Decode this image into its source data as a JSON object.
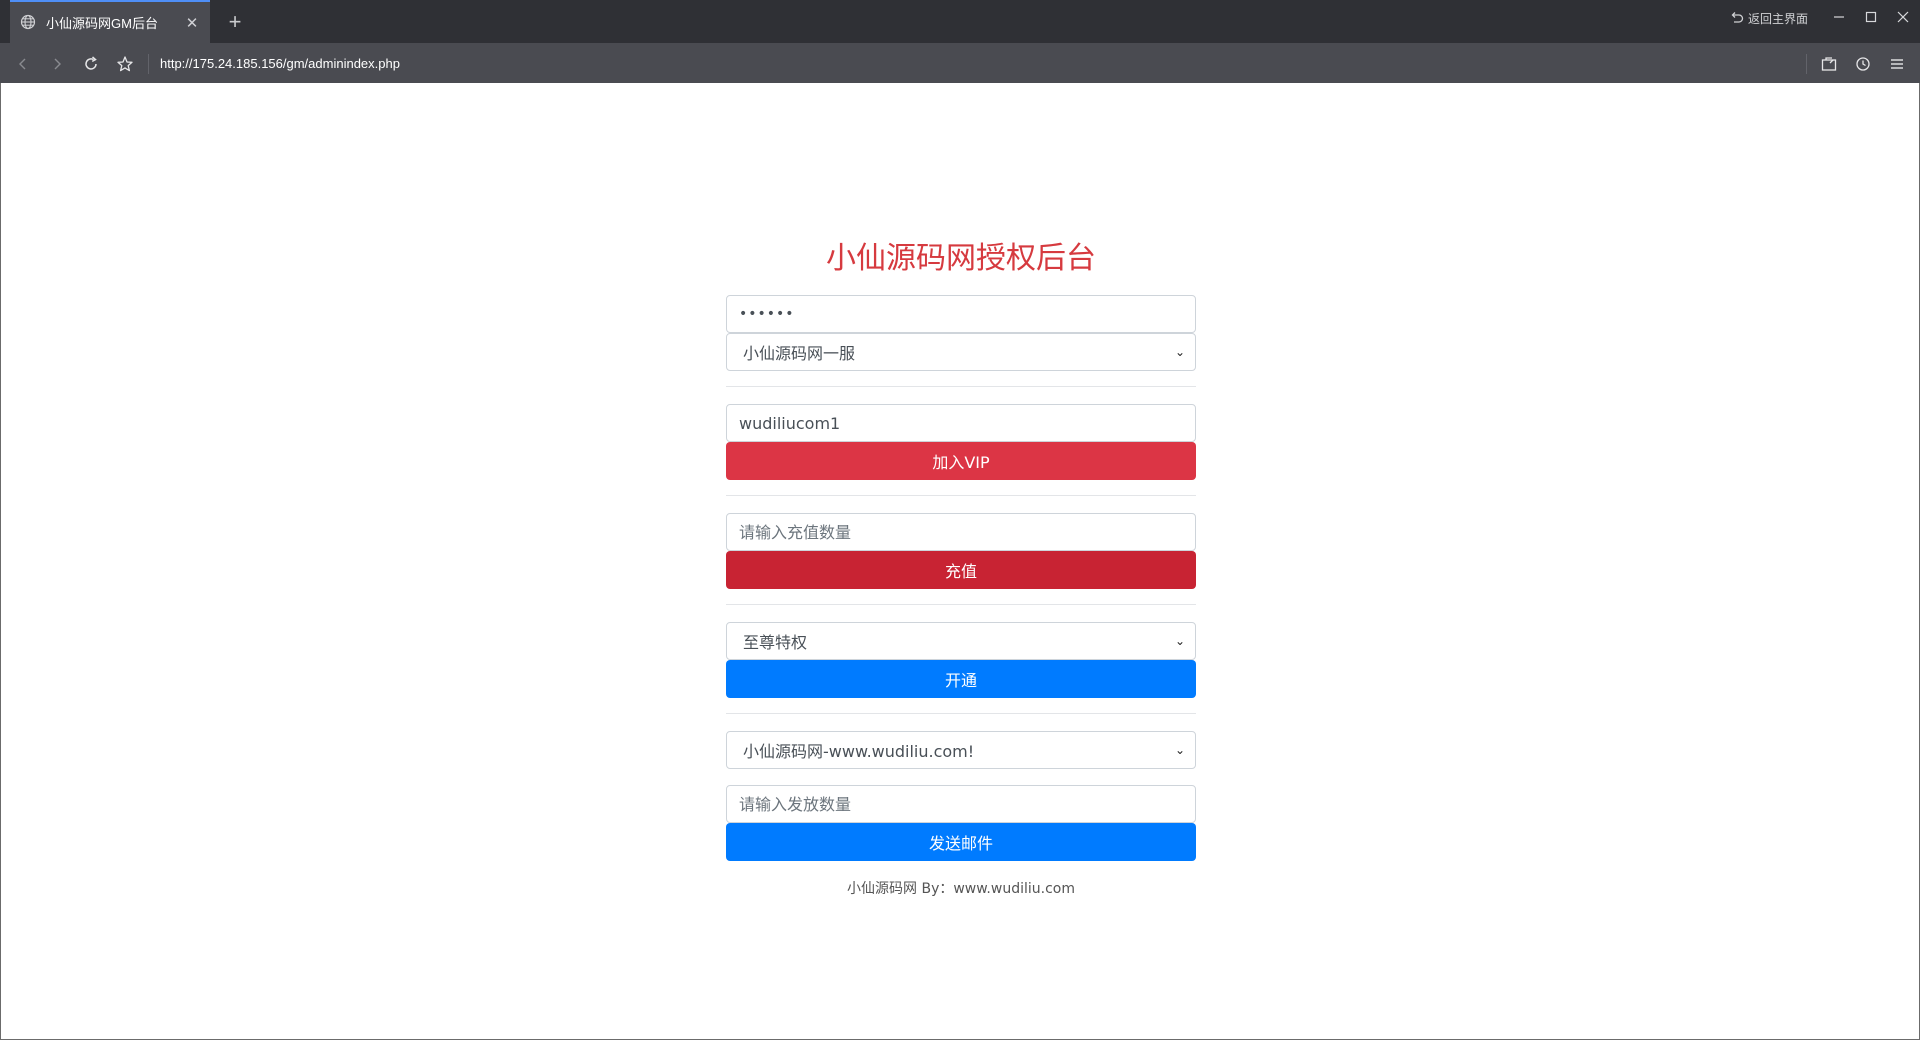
{
  "browser": {
    "tab_title": "小仙源码网GM后台",
    "address_url": "http://175.24.185.156/gm/adminindex.php",
    "return_home_label": "返回主界面"
  },
  "page": {
    "heading": "小仙源码网授权后台",
    "password_value": "••••••",
    "server_select": "小仙源码网一服",
    "account_value": "wudiliucom1",
    "vip_button": "加入VIP",
    "recharge_placeholder": "请输入充值数量",
    "recharge_button": "充值",
    "privilege_select": "至尊特权",
    "open_button": "开通",
    "mail_item_select": "小仙源码网-www.wudiliu.com!",
    "mail_amount_placeholder": "请输入发放数量",
    "send_mail_button": "发送邮件",
    "footer": "小仙源码网 By：www.wudiliu.com"
  },
  "colors": {
    "heading": "#d63a3f",
    "vip_button": "#dc3545",
    "recharge_button": "#c82333",
    "primary_button": "#007bff"
  }
}
